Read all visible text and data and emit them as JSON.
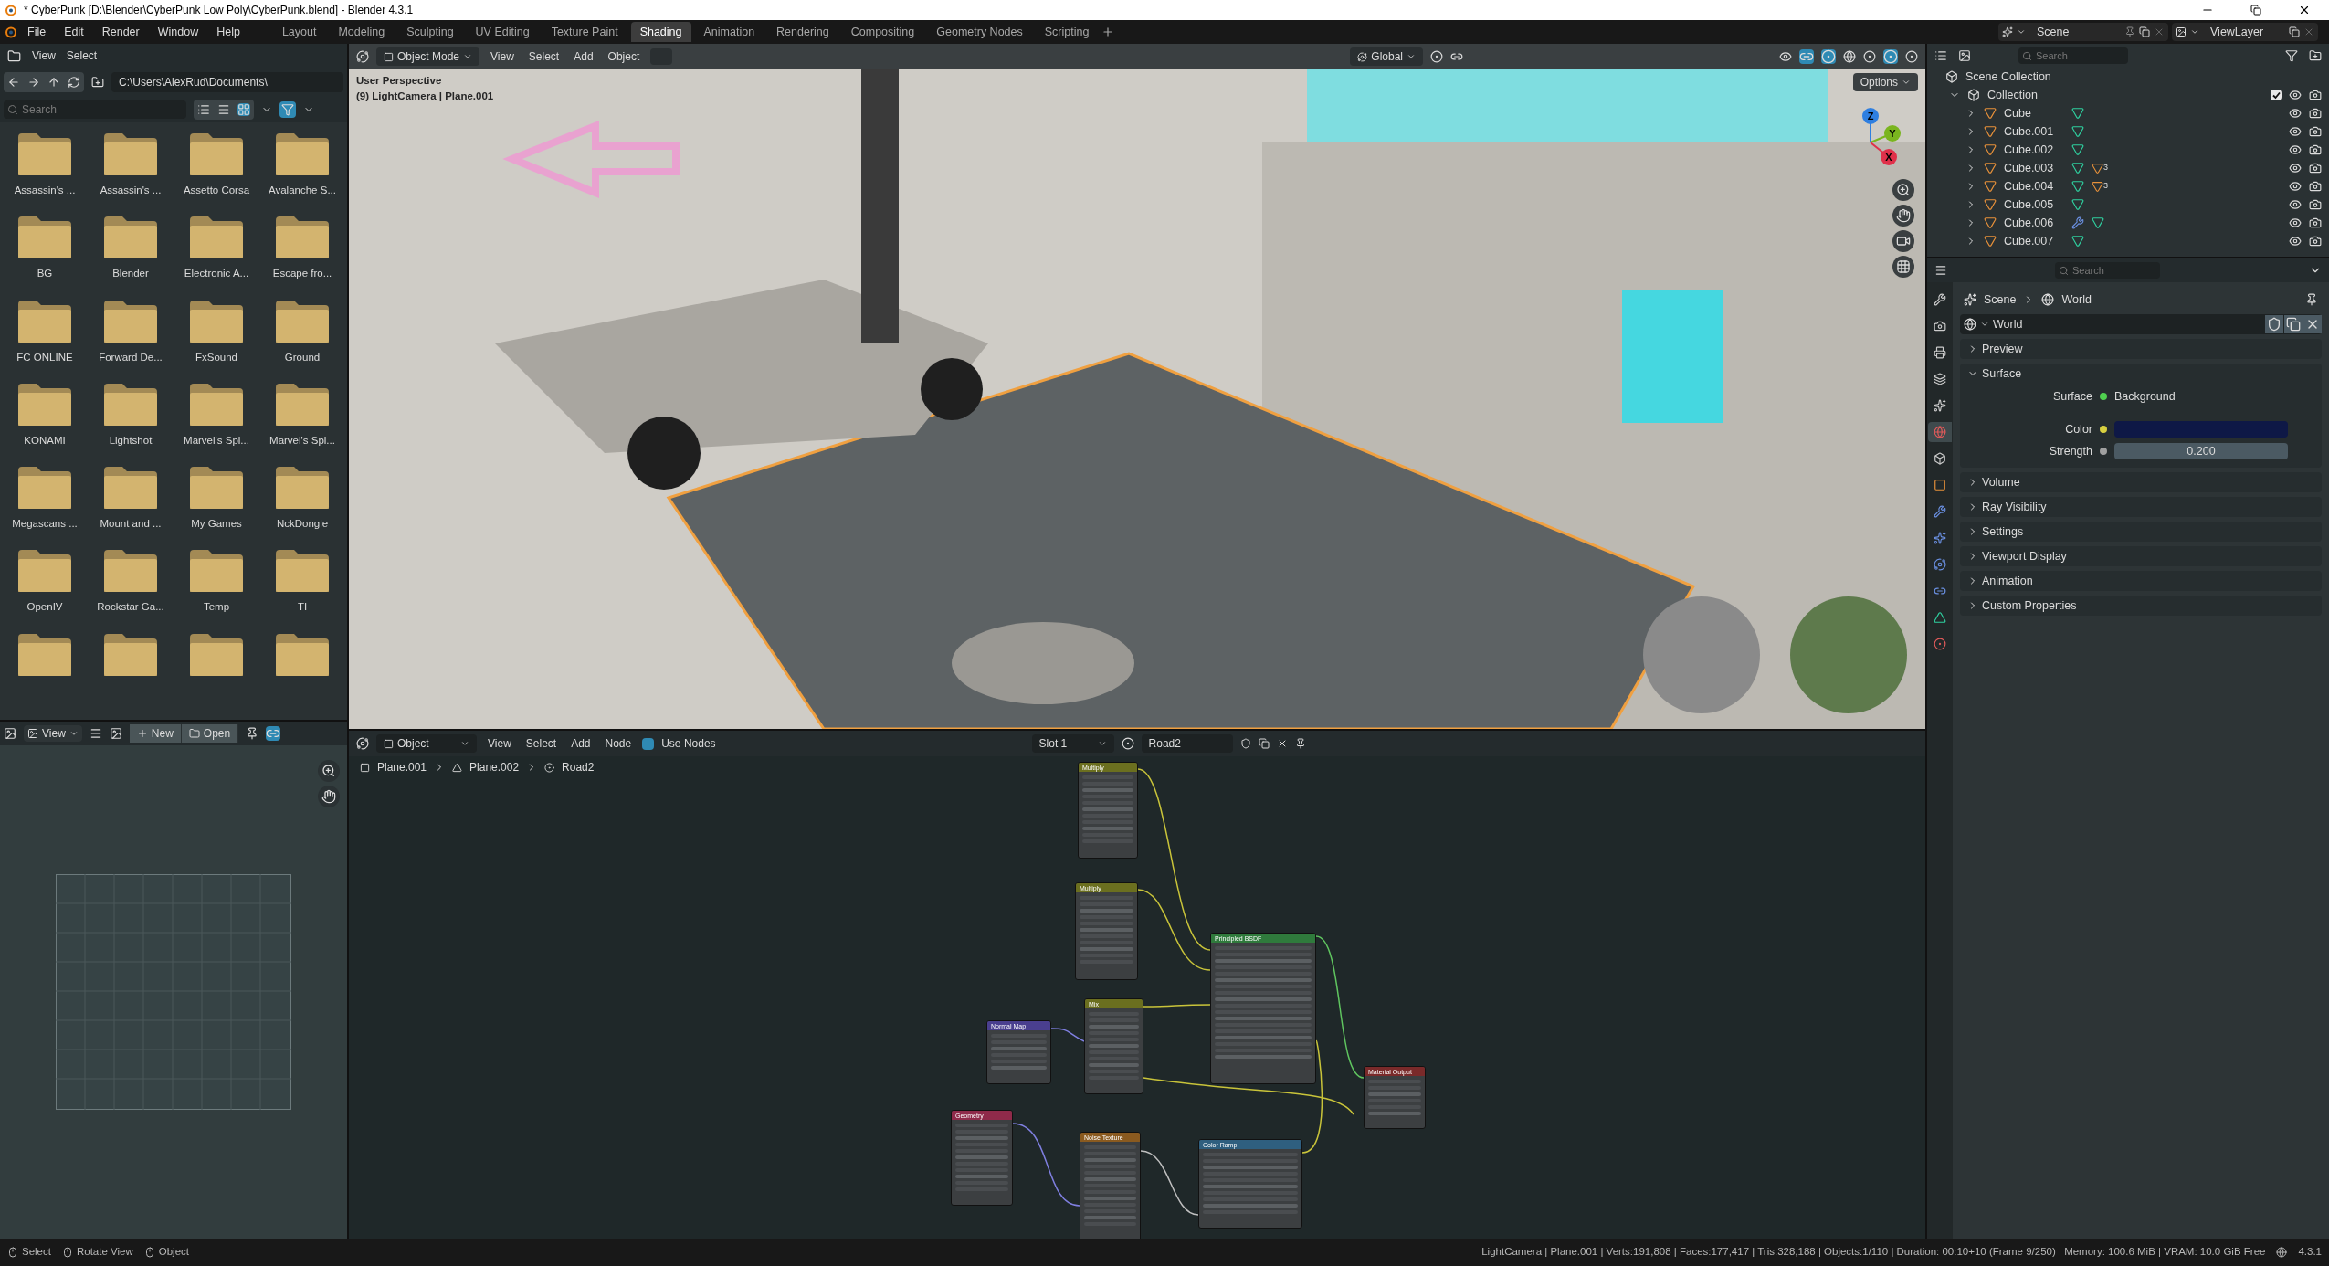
{
  "title_bar": {
    "title": "* CyberPunk [D:\\Blender\\CyberPunk Low Poly\\CyberPunk.blend] - Blender 4.3.1"
  },
  "menu": [
    "File",
    "Edit",
    "Render",
    "Window",
    "Help"
  ],
  "workspaces": [
    {
      "label": "Layout",
      "selected": false
    },
    {
      "label": "Modeling",
      "selected": false
    },
    {
      "label": "Sculpting",
      "selected": false
    },
    {
      "label": "UV Editing",
      "selected": false
    },
    {
      "label": "Texture Paint",
      "selected": false
    },
    {
      "label": "Shading",
      "selected": true
    },
    {
      "label": "Animation",
      "selected": false
    },
    {
      "label": "Rendering",
      "selected": false
    },
    {
      "label": "Compositing",
      "selected": false
    },
    {
      "label": "Geometry Nodes",
      "selected": false
    },
    {
      "label": "Scripting",
      "selected": false
    }
  ],
  "scene": {
    "name": "Scene",
    "view_layer": "ViewLayer"
  },
  "file_browser": {
    "menu": [
      "View",
      "Select"
    ],
    "path": "C:\\Users\\AlexRud\\Documents\\",
    "search_placeholder": "Search",
    "folders": [
      "Assassin's ...",
      "Assassin's ...",
      "Assetto Corsa",
      "Avalanche S...",
      "BG",
      "Blender",
      "Electronic A...",
      "Escape fro...",
      "FC ONLINE",
      "Forward De...",
      "FxSound",
      "Ground",
      "KONAMI",
      "Lightshot",
      "Marvel's Spi...",
      "Marvel's Spi...",
      "Megascans ...",
      "Mount and ...",
      "My Games",
      "NckDongle",
      "OpenIV",
      "Rockstar Ga...",
      "Temp",
      "TI"
    ]
  },
  "image_editor": {
    "menu": [
      "View"
    ],
    "buttons": [
      "New",
      "Open"
    ]
  },
  "viewport": {
    "mode": "Object Mode",
    "menu": [
      "View",
      "Select",
      "Add",
      "Object"
    ],
    "orientation": "Global",
    "overlay_text": [
      "User Perspective",
      "(9) LightCamera | Plane.001"
    ],
    "options": "Options",
    "gizmo_axes": [
      "Z",
      "Y",
      "X"
    ]
  },
  "node_editor": {
    "mode": "Object",
    "menu": [
      "View",
      "Select",
      "Add",
      "Node"
    ],
    "use_nodes": {
      "label": "Use Nodes",
      "checked": true
    },
    "slot": "Slot 1",
    "material": "Road2",
    "breadcrumbs": [
      "Plane.001",
      "Plane.002",
      "Road2"
    ],
    "nodes": [
      {
        "title": "Multiply",
        "color": "#6b6f1f"
      },
      {
        "title": "Multiply",
        "color": "#6b6f1f"
      },
      {
        "title": "Principled BSDF",
        "color": "#2f7a3c"
      },
      {
        "title": "Mix",
        "color": "#6b6f1f"
      },
      {
        "title": "Normal Map",
        "color": "#4a3f8f"
      },
      {
        "title": "Geometry",
        "color": "#8f2a4a"
      },
      {
        "title": "Noise Texture",
        "color": "#8a5a1f"
      },
      {
        "title": "Color Ramp",
        "color": "#2f5f7f"
      },
      {
        "title": "Material Output",
        "color": "#7a2a2a"
      }
    ]
  },
  "outliner": {
    "search_placeholder": "Search",
    "root": "Scene Collection",
    "collection": {
      "name": "Collection",
      "expanded": true,
      "checked": true,
      "children": [
        {
          "name": "Cube",
          "modifier": false
        },
        {
          "name": "Cube.001",
          "modifier": false
        },
        {
          "name": "Cube.002",
          "modifier": false
        },
        {
          "name": "Cube.003",
          "modifier": false,
          "badge": "3"
        },
        {
          "name": "Cube.004",
          "modifier": false,
          "badge": "3"
        },
        {
          "name": "Cube.005",
          "modifier": false
        },
        {
          "name": "Cube.006",
          "modifier": true
        },
        {
          "name": "Cube.007",
          "modifier": false
        }
      ]
    }
  },
  "properties": {
    "search_placeholder": "Search",
    "tabs": [
      {
        "kind": "tool",
        "selected": false
      },
      {
        "kind": "render",
        "selected": false
      },
      {
        "kind": "output",
        "selected": false
      },
      {
        "kind": "view_layer",
        "selected": false
      },
      {
        "kind": "scene",
        "selected": false
      },
      {
        "kind": "world",
        "selected": true
      },
      {
        "kind": "collection",
        "selected": false
      },
      {
        "kind": "object",
        "selected": false
      },
      {
        "kind": "modifier",
        "selected": false
      },
      {
        "kind": "particles",
        "selected": false
      },
      {
        "kind": "physics",
        "selected": false
      },
      {
        "kind": "constraints",
        "selected": false
      },
      {
        "kind": "data",
        "selected": false
      },
      {
        "kind": "material",
        "selected": false
      }
    ],
    "breadcrumbs": [
      "Scene",
      "World"
    ],
    "datablock": "World",
    "panels": [
      {
        "label": "Preview",
        "expanded": false
      },
      {
        "label": "Surface",
        "expanded": true,
        "rows": [
          {
            "kind": "shader",
            "label": "Surface",
            "value": "Background"
          },
          {
            "kind": "color",
            "label": "Color",
            "color": "#0e1846"
          },
          {
            "kind": "number",
            "label": "Strength",
            "value": "0.200"
          }
        ]
      },
      {
        "label": "Volume",
        "expanded": false
      },
      {
        "label": "Ray Visibility",
        "expanded": false
      },
      {
        "label": "Settings",
        "expanded": false
      },
      {
        "label": "Viewport Display",
        "expanded": false
      },
      {
        "label": "Animation",
        "expanded": false
      },
      {
        "label": "Custom Properties",
        "expanded": false
      }
    ]
  },
  "status_bar": {
    "hints": [
      "Select",
      "Rotate View",
      "Object"
    ],
    "stats": "LightCamera | Plane.001 | Verts:191,808 | Faces:177,417 | Tris:328,188 | Objects:1/110 | Duration: 00:10+10 (Frame 9/250) | Memory: 100.6 MiB | VRAM: 10.0 GiB Free",
    "version": "4.3.1"
  }
}
